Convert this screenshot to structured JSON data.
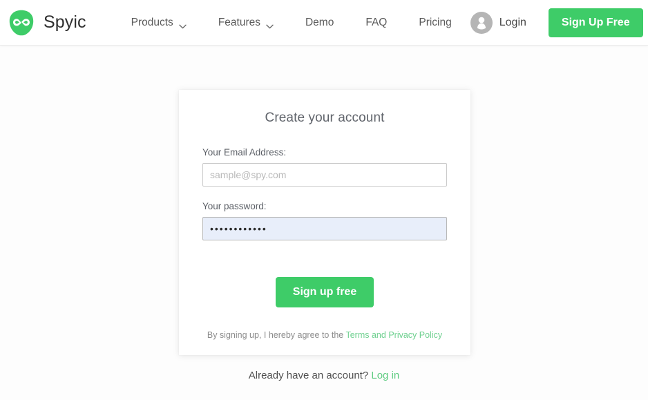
{
  "brand": {
    "name": "Spyic",
    "logo_icon": "infinity-logo-icon",
    "logo_color": "#3ECC68"
  },
  "header": {
    "nav": [
      {
        "label": "Products",
        "has_dropdown": true,
        "icon": "chevron-down-icon"
      },
      {
        "label": "Features",
        "has_dropdown": true,
        "icon": "chevron-down-icon"
      },
      {
        "label": "Demo",
        "has_dropdown": false
      },
      {
        "label": "FAQ",
        "has_dropdown": false
      },
      {
        "label": "Pricing",
        "has_dropdown": false
      }
    ],
    "login": {
      "label": "Login",
      "icon": "user-avatar-icon",
      "icon_color": "#b5b5b5"
    },
    "signup_button": {
      "label": "Sign Up Free",
      "color": "#3ECC68"
    }
  },
  "signup_card": {
    "title": "Create your account",
    "email": {
      "label": "Your Email Address:",
      "placeholder": "sample@spy.com",
      "value": ""
    },
    "password": {
      "label": "Your password:",
      "value": "••••••••••••",
      "placeholder": "",
      "autofill_background": "#e8eefa"
    },
    "submit_button": {
      "label": "Sign up free",
      "color": "#3ECC68"
    },
    "terms": {
      "text": "By signing up, I hereby agree to the",
      "link": "Terms and Privacy Policy"
    }
  },
  "footer": {
    "text": "Already have an account?",
    "link": "Log in"
  }
}
